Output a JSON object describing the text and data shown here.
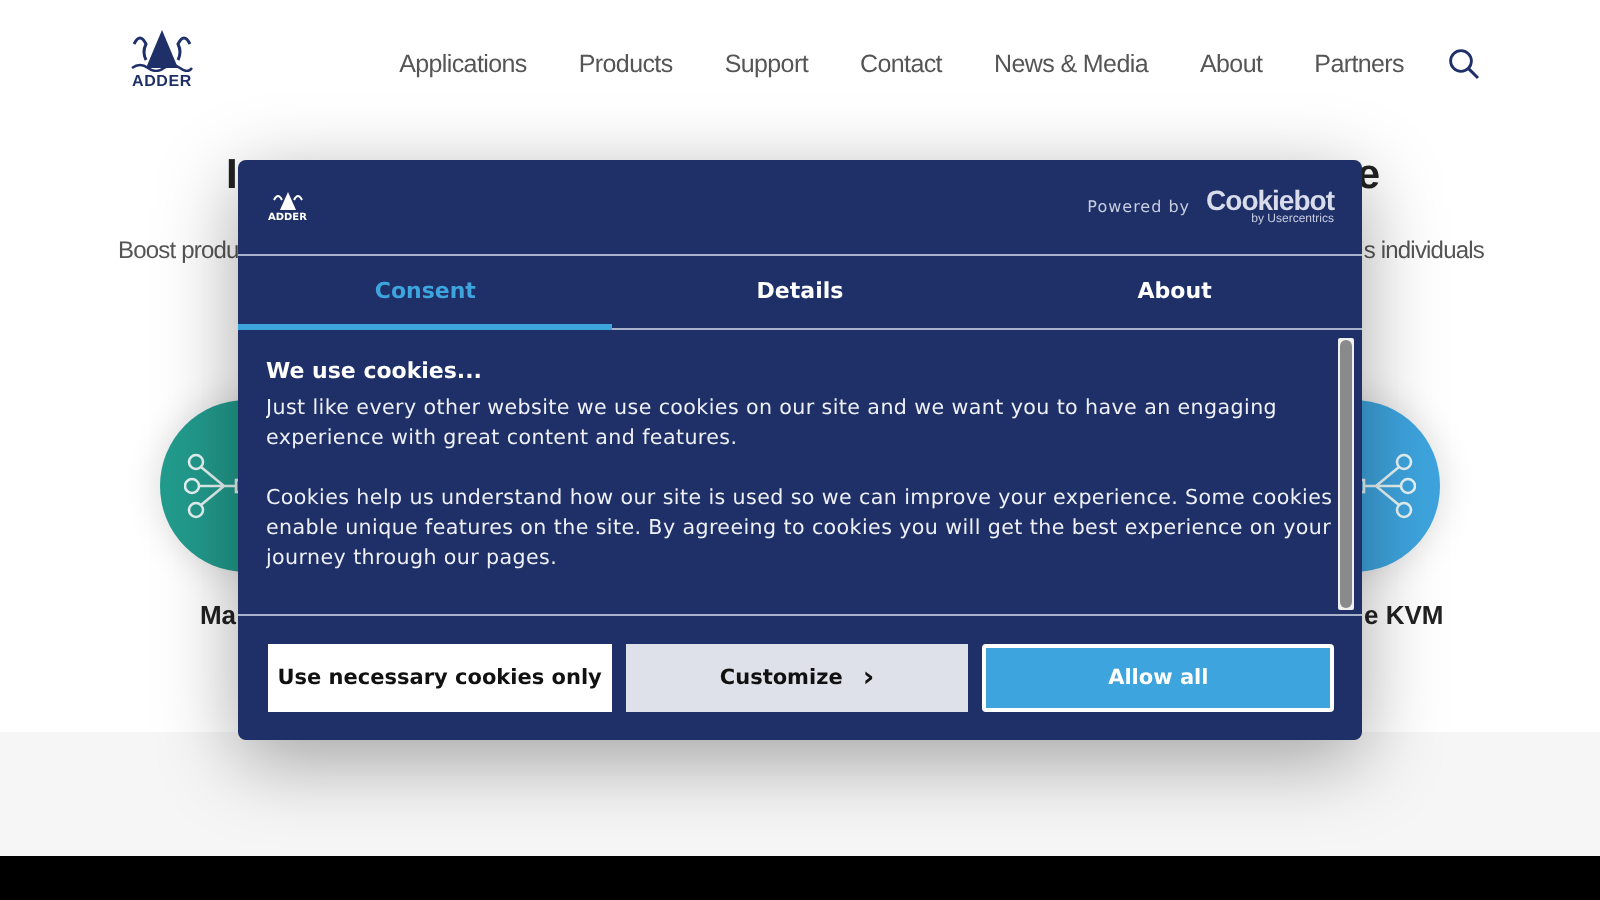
{
  "header": {
    "logo_text": "ADDER",
    "nav": [
      {
        "label": "Applications"
      },
      {
        "label": "Products"
      },
      {
        "label": "Support"
      },
      {
        "label": "Contact"
      },
      {
        "label": "News & Media"
      },
      {
        "label": "About"
      },
      {
        "label": "Partners"
      }
    ]
  },
  "background": {
    "heading_start": "I",
    "heading_end": "e",
    "intro_start": "Boost produ",
    "intro_end": "s individuals",
    "cards": [
      {
        "label": "Ma",
        "color": "#229b8d"
      },
      {
        "label": "e KVM",
        "color": "#3ea4de"
      }
    ]
  },
  "cookie_dialog": {
    "logo_text": "ADDER",
    "powered_by": "Powered by",
    "brand": "Cookiebot",
    "brand_sub": "by Usercentrics",
    "tabs": [
      {
        "label": "Consent",
        "selected": true
      },
      {
        "label": "Details",
        "selected": false
      },
      {
        "label": "About",
        "selected": false
      }
    ],
    "title": "We use cookies...",
    "paragraphs": [
      "Just like every other website we use cookies on our site and we want you to have an engaging experience with great content and features.",
      "Cookies help us understand how our site is used so we can improve your experience. Some cookies enable unique features on the site. By agreeing to cookies you will get the best experience on your journey through our pages."
    ],
    "buttons": [
      {
        "kind": "outline",
        "label": "Use necessary cookies only"
      },
      {
        "kind": "secondary",
        "label": "Customize",
        "chevron": "›"
      },
      {
        "kind": "primary",
        "label": "Allow all"
      }
    ]
  }
}
